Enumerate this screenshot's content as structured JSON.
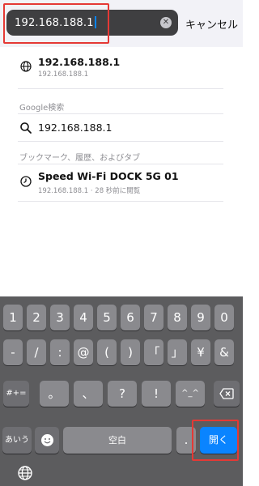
{
  "search": {
    "value": "192.168.188.1",
    "clear_icon": "clear-icon",
    "cancel_label": "キャンセル"
  },
  "suggestions": {
    "top_hit": {
      "title": "192.168.188.1",
      "subtitle": "192.168.188.1",
      "icon": "globe-icon"
    },
    "google_section_label": "Google検索",
    "google_query": {
      "title": "192.168.188.1",
      "icon": "search-icon"
    },
    "bookmarks_section_label": "ブックマーク、履歴、およびタブ",
    "history_item": {
      "title": "Speed Wi-Fi DOCK 5G 01",
      "subtitle": "192.168.188.1 · 28 秒前に閲覧",
      "icon": "clock-icon"
    }
  },
  "keyboard": {
    "row1": [
      "1",
      "2",
      "3",
      "4",
      "5",
      "6",
      "7",
      "8",
      "9",
      "0"
    ],
    "row2": [
      "-",
      "/",
      ":",
      "@",
      "(",
      ")",
      "「",
      "」",
      "¥",
      "&"
    ],
    "row3": [
      "#+=",
      "。",
      "、",
      "?",
      "!",
      "^_^"
    ],
    "row3_delete_icon": "delete-icon",
    "row4": {
      "kana": "あいう",
      "emoji_icon": "emoji-icon",
      "space": "空白",
      "dot": ".",
      "open": "開く"
    },
    "globe_icon": "globe-icon",
    "colors": {
      "open_key": "#0a84ff",
      "highlight": "#e53935"
    }
  }
}
